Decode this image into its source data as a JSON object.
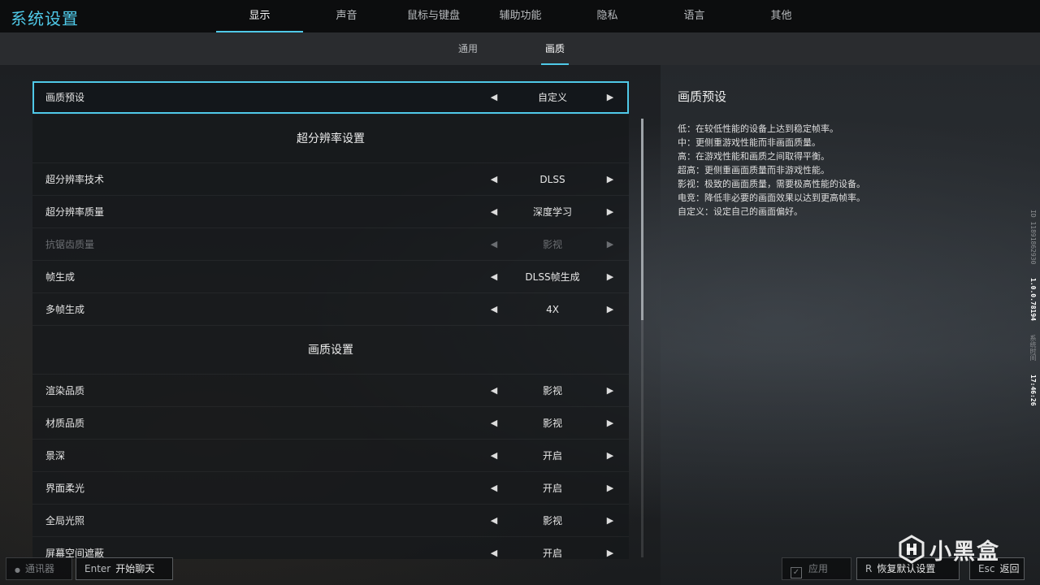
{
  "header": {
    "title": "系统设置",
    "tabs": [
      "显示",
      "声音",
      "鼠标与键盘",
      "辅助功能",
      "隐私",
      "语言",
      "其他"
    ],
    "active_tab": "显示"
  },
  "subtabs": {
    "items": [
      "通用",
      "画质"
    ],
    "active": "画质"
  },
  "settings": {
    "preset": {
      "label": "画质预设",
      "value": "自定义"
    },
    "section1": "超分辨率设置",
    "sr_tech": {
      "label": "超分辨率技术",
      "value": "DLSS"
    },
    "sr_quality": {
      "label": "超分辨率质量",
      "value": "深度学习"
    },
    "aa_quality": {
      "label": "抗锯齿质量",
      "value": "影视"
    },
    "frame_gen": {
      "label": "帧生成",
      "value": "DLSS帧生成"
    },
    "multi_frame_gen": {
      "label": "多帧生成",
      "value": "4X"
    },
    "section2": "画质设置",
    "render_quality": {
      "label": "渲染品质",
      "value": "影视"
    },
    "material_quality": {
      "label": "材质品质",
      "value": "影视"
    },
    "dof": {
      "label": "景深",
      "value": "开启"
    },
    "ui_bloom": {
      "label": "界面柔光",
      "value": "开启"
    },
    "gi": {
      "label": "全局光照",
      "value": "影视"
    },
    "ssao": {
      "label": "屏幕空间遮蔽",
      "value": "开启"
    },
    "arrow_left": "◀",
    "arrow_right": "▶"
  },
  "description": {
    "title": "画质预设",
    "lines": [
      "低：在较低性能的设备上达到稳定帧率。",
      "中：更侧重游戏性能而非画面质量。",
      "高：在游戏性能和画质之间取得平衡。",
      "超高：更侧重画面质量而非游戏性能。",
      "影视：极致的画面质量，需要极高性能的设备。",
      "电竞：降低非必要的画面效果以达到更高帧率。",
      "自定义：设定自己的画面偏好。"
    ]
  },
  "side_info": {
    "id": "ID 11891862930",
    "version": "1.0.0.78194",
    "time_label": "系统时间",
    "time": "17:46:26"
  },
  "footer": {
    "comms_label": "通讯器",
    "chat_key": "Enter",
    "chat_label": "开始聊天",
    "apply_label": "应用",
    "reset_key": "R",
    "reset_label": "恢复默认设置",
    "back_key": "Esc",
    "back_label": "返回"
  },
  "watermark": {
    "text": "小黑盒"
  },
  "colors": {
    "accent": "#4fc9e8",
    "disabled": "#6b6e72"
  }
}
